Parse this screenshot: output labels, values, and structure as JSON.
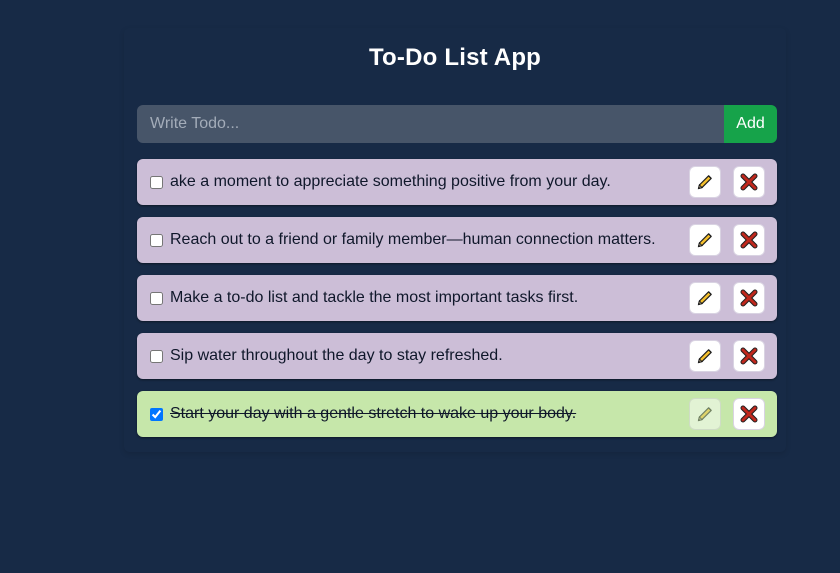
{
  "app": {
    "title": "To-Do List App"
  },
  "input": {
    "placeholder": "Write Todo...",
    "value": ""
  },
  "add_button": {
    "label": "Add"
  },
  "todos": [
    {
      "text": "ake a moment to appreciate something positive from your day.",
      "completed": false
    },
    {
      "text": " Reach out to a friend or family member—human connection matters.",
      "completed": false
    },
    {
      "text": "Make a to-do list and tackle the most important tasks first.",
      "completed": false
    },
    {
      "text": "Sip water throughout the day to stay refreshed.",
      "completed": false
    },
    {
      "text": "Start your day with a gentle stretch to wake up your body.",
      "completed": true
    }
  ],
  "icons": {
    "edit": "pencil-icon",
    "delete": "cross-mark-icon"
  },
  "colors": {
    "background": "#172a46",
    "input_bg": "#475569",
    "add_button": "#16a34a",
    "todo_bg": "#ccbed7",
    "todo_done_bg": "#c6e7aa",
    "delete_x": "#c0281d",
    "pencil": "#f4bf2d"
  }
}
